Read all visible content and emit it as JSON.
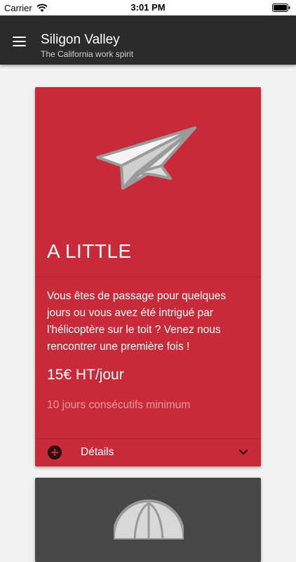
{
  "status_bar": {
    "carrier": "Carrier",
    "time": "3:01 PM",
    "icons": [
      "wifi-icon",
      "battery-icon"
    ]
  },
  "app_bar": {
    "title": "Siligon Valley",
    "subtitle": "The California work spirit",
    "menu_icon": "hamburger-menu-icon"
  },
  "cards": [
    {
      "image_icon": "paper-plane-icon",
      "title": "A LITTLE",
      "description": "Vous êtes de passage pour quelques jours ou vous avez été intrigué par l'hélicoptère sur le toit ? Venez nous rencontrer une première fois !",
      "price": "15€ HT/jour",
      "minimum": "10 jours consécutifs minimum",
      "details_label": "Détails",
      "details_icon": "plus-circle-icon",
      "expand_icon": "chevron-down-icon",
      "background_color": "#c92a3a"
    },
    {
      "image_icon": "hot-air-balloon-icon",
      "background_color": "#474747"
    }
  ],
  "colors": {
    "app_bar": "#2b2b2b",
    "page_background": "#f2f2f2",
    "card_accent": "#c92a3a",
    "muted_text": "#e89aa3"
  }
}
